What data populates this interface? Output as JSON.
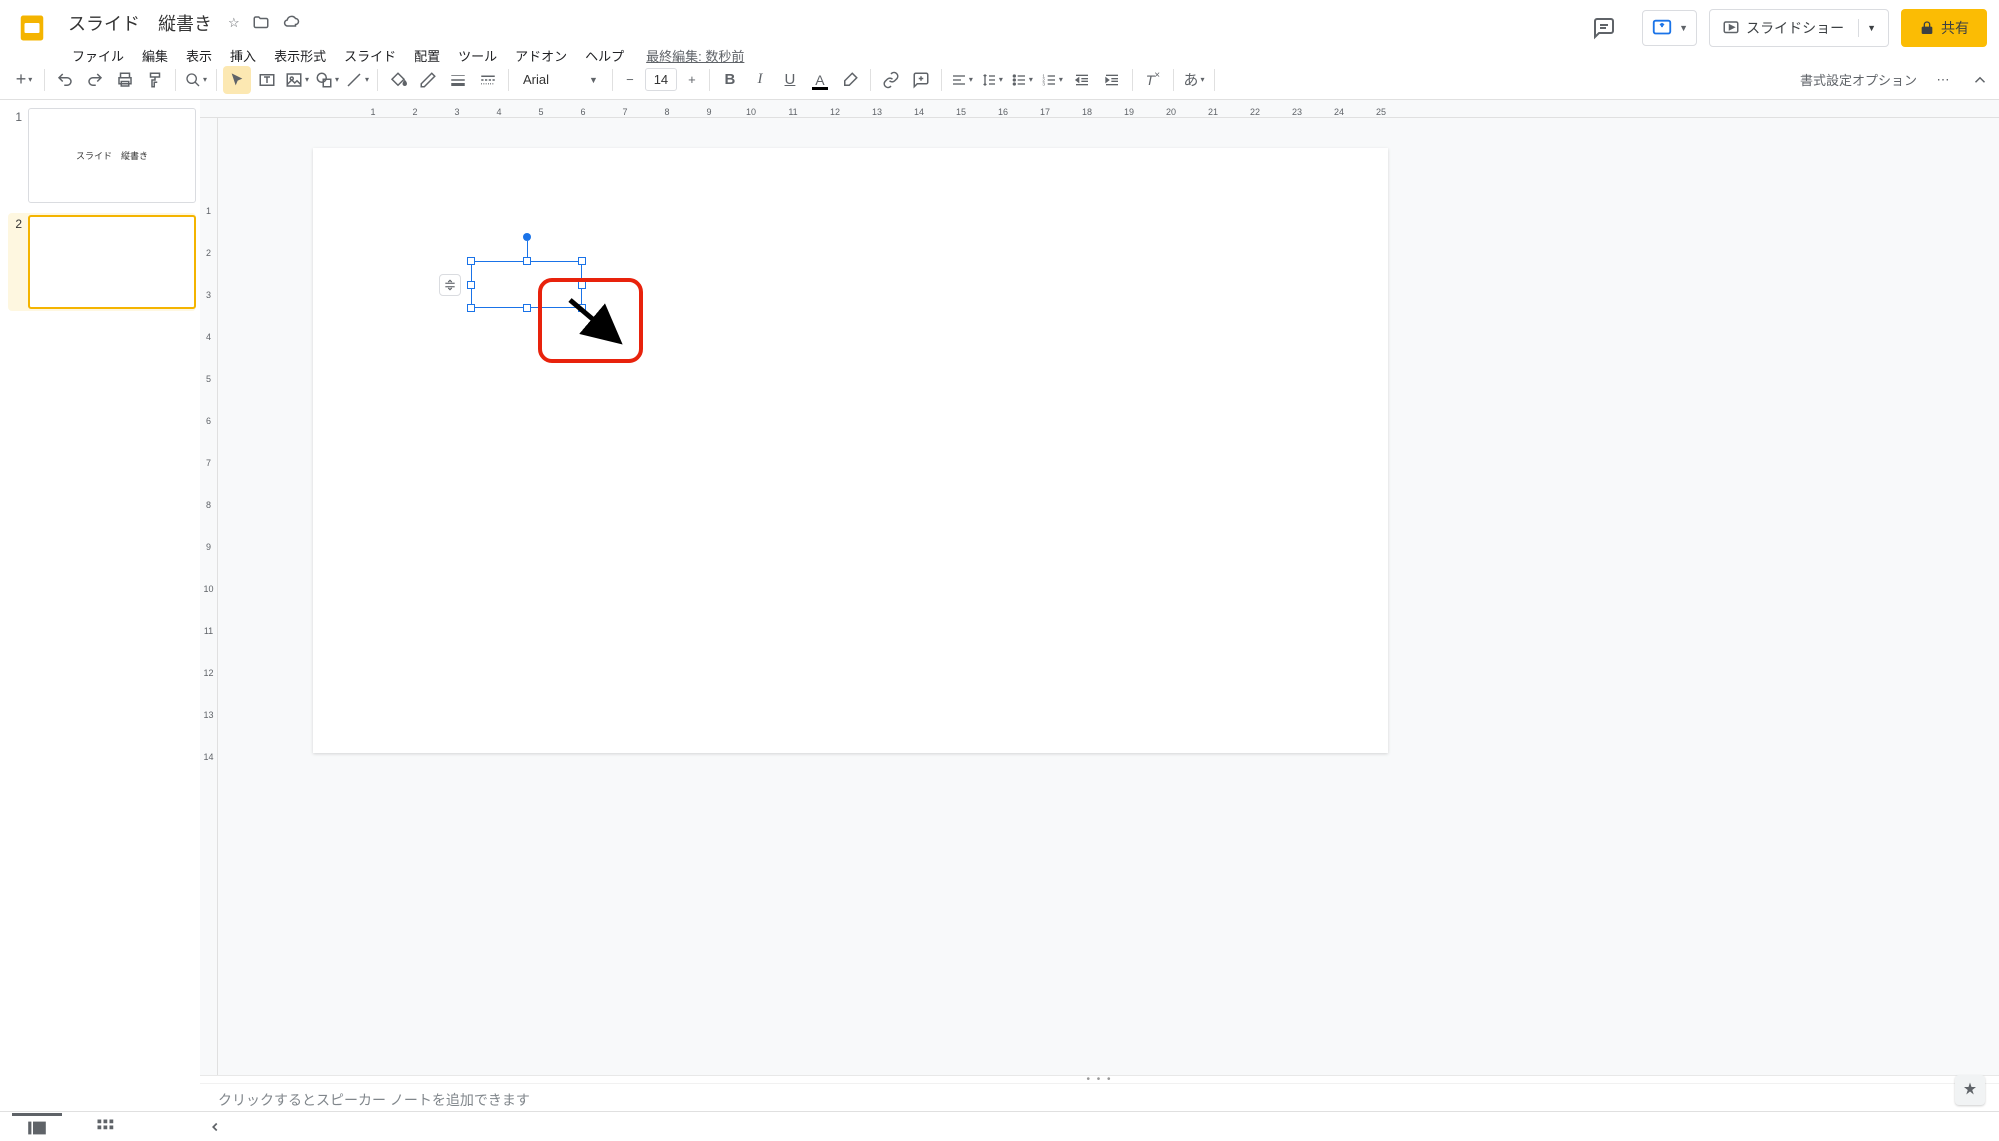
{
  "header": {
    "doc_title": "スライド　縦書き",
    "last_edit": "最終編集: 数秒前",
    "menus": [
      "ファイル",
      "編集",
      "表示",
      "挿入",
      "表示形式",
      "スライド",
      "配置",
      "ツール",
      "アドオン",
      "ヘルプ"
    ],
    "slideshow_label": "スライドショー",
    "share_label": "共有"
  },
  "toolbar": {
    "font_name": "Arial",
    "font_size": "14",
    "format_options": "書式設定オプション"
  },
  "ruler_h": [
    "",
    "1",
    "2",
    "3",
    "4",
    "5",
    "6",
    "7",
    "8",
    "9",
    "10",
    "11",
    "12",
    "13",
    "14",
    "15",
    "16",
    "17",
    "18",
    "19",
    "20",
    "21",
    "22",
    "23",
    "24",
    "25"
  ],
  "ruler_v": [
    "",
    "1",
    "2",
    "3",
    "4",
    "5",
    "6",
    "7",
    "8",
    "9",
    "10",
    "11",
    "12",
    "13",
    "14"
  ],
  "slides": [
    {
      "num": "1",
      "thumb_text": "スライド　縦書き",
      "selected": false
    },
    {
      "num": "2",
      "thumb_text": "",
      "selected": true
    }
  ],
  "notes_placeholder": "クリックするとスピーカー ノートを追加できます"
}
